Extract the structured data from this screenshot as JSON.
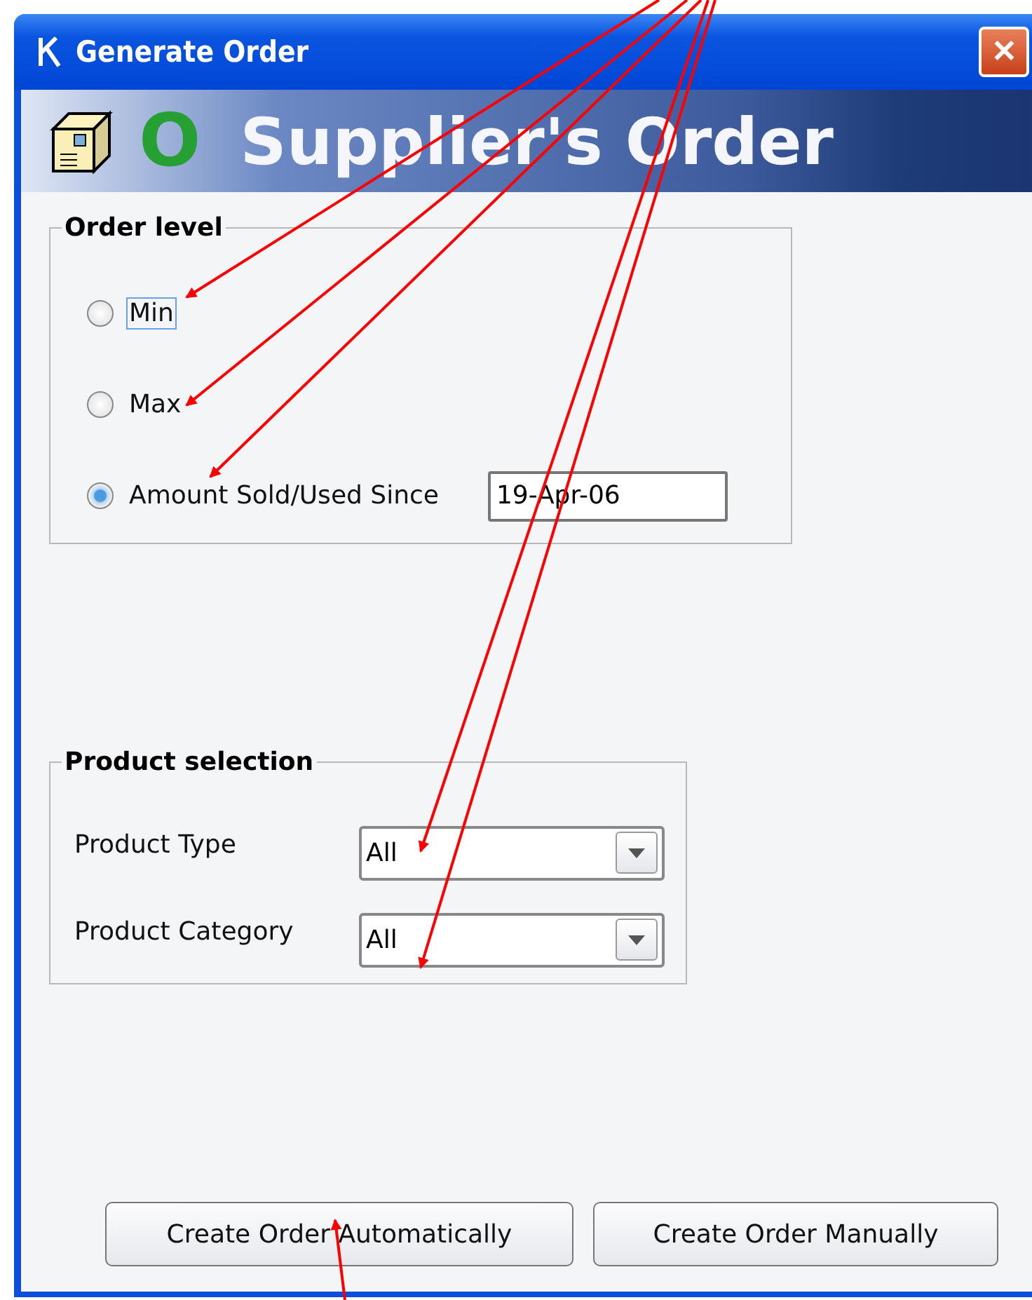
{
  "window": {
    "title": "Generate Order",
    "close": "✕"
  },
  "banner": {
    "letter": "O",
    "title": "Supplier's Order"
  },
  "order_level": {
    "legend": "Order level",
    "options": [
      {
        "label": "Min",
        "selected": false,
        "focused": true
      },
      {
        "label": "Max",
        "selected": false,
        "focused": false
      },
      {
        "label": "Amount Sold/Used Since",
        "selected": true,
        "focused": false,
        "value": "19-Apr-06"
      }
    ]
  },
  "product_selection": {
    "legend": "Product selection",
    "fields": [
      {
        "label": "Product Type",
        "value": "All"
      },
      {
        "label": "Product Category",
        "value": "All"
      }
    ]
  },
  "buttons": [
    "Create Order Automatically",
    "Create Order Manually"
  ]
}
